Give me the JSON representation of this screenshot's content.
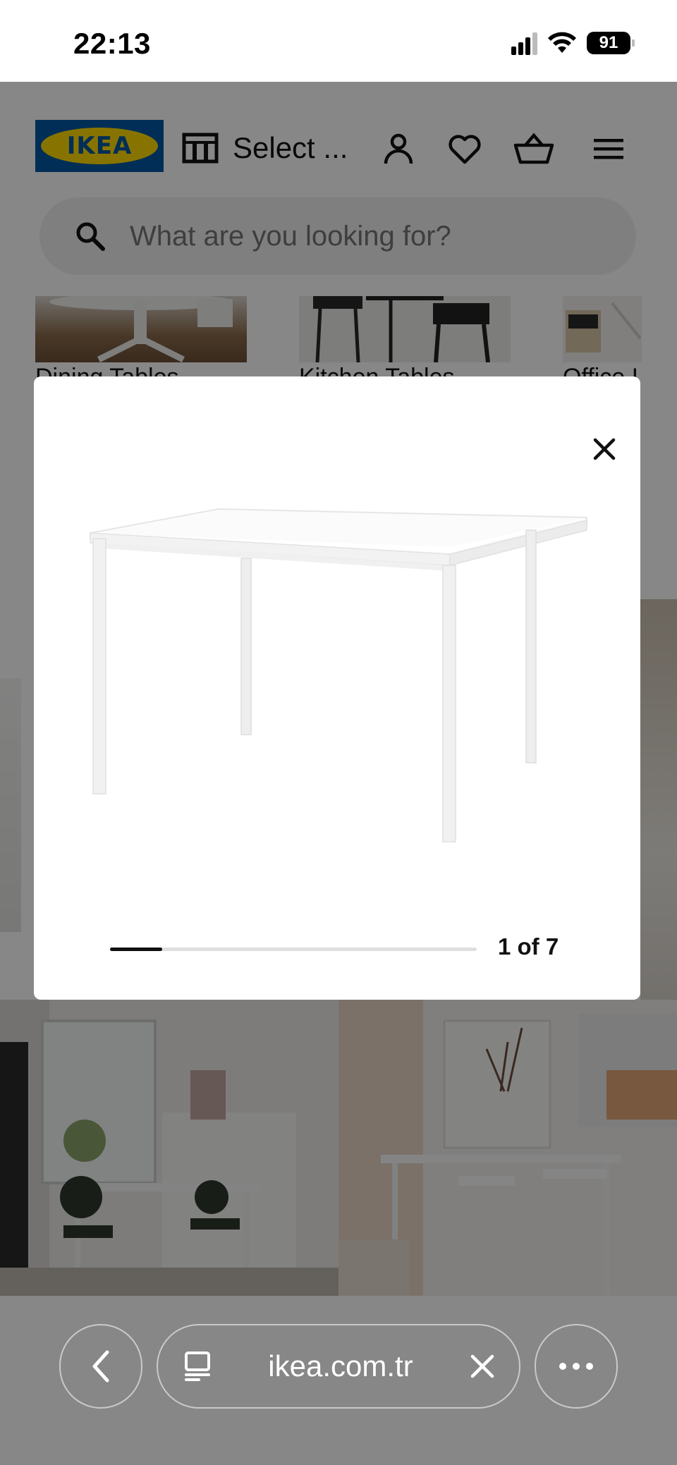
{
  "status_bar": {
    "time": "22:13",
    "battery": "91"
  },
  "header": {
    "logo_text": "IKEA",
    "store_selector": "Select ...",
    "icons": [
      "store-icon",
      "user-icon",
      "heart-icon",
      "basket-icon",
      "menu-icon"
    ]
  },
  "search": {
    "placeholder": "What are you looking for?"
  },
  "categories": [
    {
      "label": "Dining Tables"
    },
    {
      "label": "Kitchen Tables"
    },
    {
      "label": "Office I"
    }
  ],
  "modal": {
    "counter": "1 of 7",
    "progress_fraction": 0.1429,
    "close_icon": "close-icon"
  },
  "browser": {
    "url": "ikea.com.tr",
    "back_icon": "chevron-left-icon",
    "tabs_icon": "page-icon",
    "clear_icon": "close-icon",
    "more_icon": "more-icon"
  },
  "colors": {
    "ikea_blue": "#0058a3",
    "ikea_yellow": "#ffdb00"
  }
}
